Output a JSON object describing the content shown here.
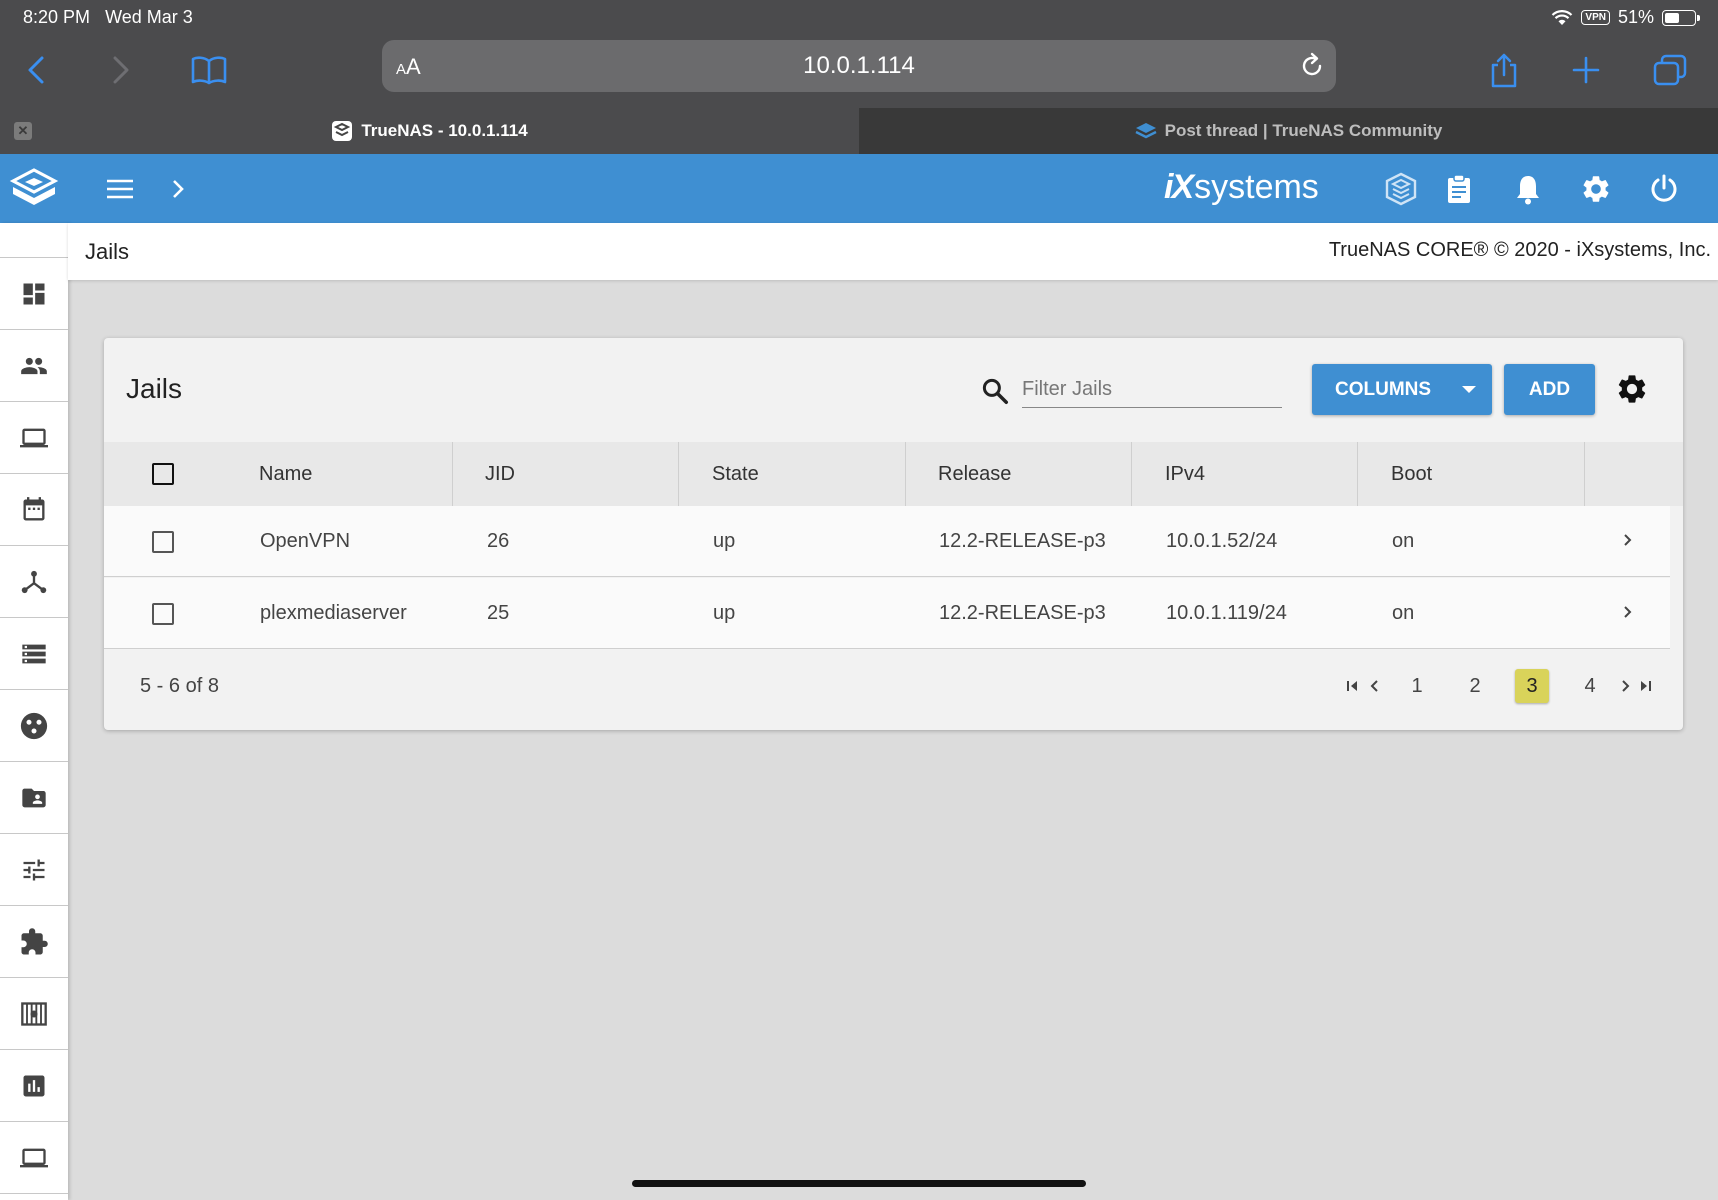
{
  "status": {
    "time": "8:20 PM",
    "date": "Wed Mar 3",
    "vpn": "VPN",
    "battery": "51%",
    "battery_level": 0.51
  },
  "browser": {
    "aa_small": "A",
    "aa_big": "A",
    "url": "10.0.1.114",
    "tabs": [
      {
        "title": "TrueNAS - 10.0.1.114",
        "active": true
      },
      {
        "title": "Post thread | TrueNAS Community",
        "active": false
      }
    ]
  },
  "header": {
    "brand_ix": "iX",
    "brand_systems": "systems"
  },
  "sidebar": {
    "items": [
      {
        "icon": "dashboard-icon"
      },
      {
        "icon": "accounts-icon"
      },
      {
        "icon": "system-icon"
      },
      {
        "icon": "tasks-calendar-icon"
      },
      {
        "icon": "network-icon"
      },
      {
        "icon": "storage-icon"
      },
      {
        "icon": "directory-services-icon"
      },
      {
        "icon": "sharing-icon"
      },
      {
        "icon": "services-icon"
      },
      {
        "icon": "plugins-icon"
      },
      {
        "icon": "jails-icon"
      },
      {
        "icon": "reporting-icon"
      },
      {
        "icon": "virtual-machines-icon"
      }
    ]
  },
  "page": {
    "breadcrumb": "Jails",
    "copyright": "TrueNAS CORE® © 2020 - iXsystems, Inc."
  },
  "card": {
    "title": "Jails",
    "filter_placeholder": "Filter Jails",
    "columns_label": "COLUMNS",
    "add_label": "ADD",
    "columns": [
      "Name",
      "JID",
      "State",
      "Release",
      "IPv4",
      "Boot"
    ],
    "rows": [
      {
        "name": "OpenVPN",
        "jid": "26",
        "state": "up",
        "release": "12.2-RELEASE-p3",
        "ipv4": "10.0.1.52/24",
        "boot": "on"
      },
      {
        "name": "plexmediaserver",
        "jid": "25",
        "state": "up",
        "release": "12.2-RELEASE-p3",
        "ipv4": "10.0.1.119/24",
        "boot": "on"
      }
    ],
    "range": "5 - 6 of 8",
    "pages": [
      "1",
      "2",
      "3",
      "4"
    ],
    "current_page": "3"
  },
  "colors": {
    "accent": "#3f8fd2",
    "active_page": "#d9d35a",
    "chrome": "#4b4b4d"
  }
}
